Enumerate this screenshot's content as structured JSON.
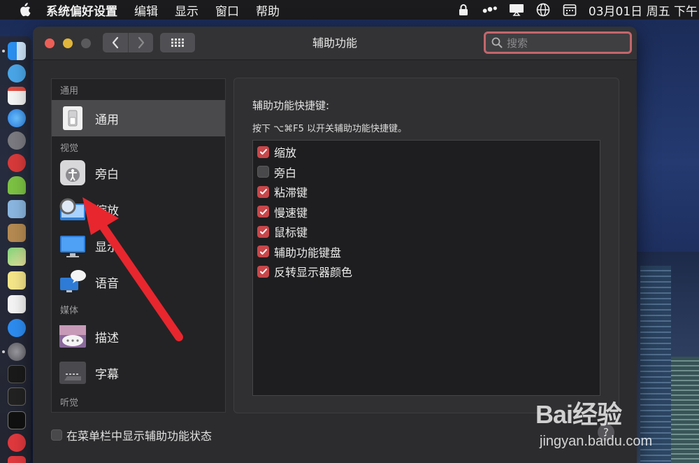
{
  "menubar": {
    "app_name": "系统偏好设置",
    "items": [
      "编辑",
      "显示",
      "窗口",
      "帮助"
    ],
    "clock": "03月01日 周五 下午"
  },
  "window": {
    "title": "辅助功能",
    "search_placeholder": "搜索"
  },
  "sidebar": {
    "section_general": "通用",
    "item_general": "通用",
    "section_vision": "视觉",
    "item_voiceover": "旁白",
    "item_zoom": "缩放",
    "item_display": "显示",
    "item_speech": "语音",
    "section_media": "媒体",
    "item_descriptions": "描述",
    "item_captions": "字幕",
    "section_hearing": "听觉"
  },
  "panel": {
    "title": "辅助功能快捷键:",
    "subtitle": "按下 ⌥⌘F5 以开关辅助功能快捷键。",
    "options": [
      {
        "label": "缩放",
        "checked": true
      },
      {
        "label": "旁白",
        "checked": false
      },
      {
        "label": "粘滞键",
        "checked": true
      },
      {
        "label": "慢速键",
        "checked": true
      },
      {
        "label": "鼠标键",
        "checked": true
      },
      {
        "label": "辅助功能键盘",
        "checked": true
      },
      {
        "label": "反转显示器颜色",
        "checked": true
      }
    ]
  },
  "footer": {
    "show_status_label": "在菜单栏中显示辅助功能状态",
    "show_status_checked": false,
    "help_label": "?"
  },
  "colors": {
    "accent_checkbox": "#c8474a",
    "search_focus_ring": "#c2676c",
    "annotation_arrow": "#e8262e"
  },
  "watermark": {
    "logo": "Bai经验",
    "url": "jingyan.baidu.com"
  }
}
